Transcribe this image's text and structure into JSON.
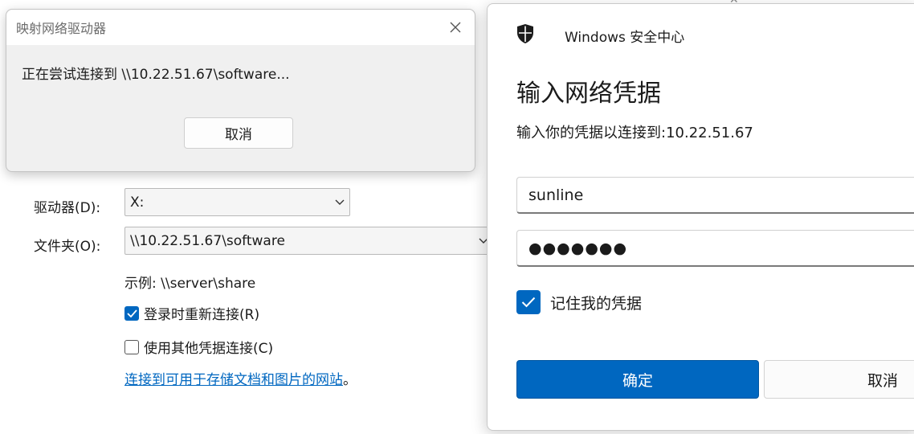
{
  "map_drive": {
    "drive_label": "驱动器(D):",
    "drive_value": "X:",
    "folder_label": "文件夹(O):",
    "folder_value": "\\\\10.22.51.67\\software",
    "example": "示例: \\\\server\\share",
    "reconnect_label": "登录时重新连接(R)",
    "reconnect_checked": true,
    "other_cred_label": "使用其他凭据连接(C)",
    "other_cred_checked": false,
    "link_text": "连接到可用于存储文档和图片的网站",
    "link_suffix": "。"
  },
  "progress_popup": {
    "title": "映射网络驱动器",
    "message": "正在尝试连接到 \\\\10.22.51.67\\software...",
    "cancel_label": "取消"
  },
  "security_dialog": {
    "app_title": "Windows 安全中心",
    "heading": "输入网络凭据",
    "subtitle": "输入你的凭据以连接到:10.22.51.67",
    "username_value": "sunline",
    "password_mask": "●●●●●●●",
    "remember_label": "记住我的凭据",
    "remember_checked": true,
    "ok_label": "确定",
    "cancel_label": "取消"
  },
  "colors": {
    "accent": "#0067c0",
    "popup_bg": "#f0f0f0"
  },
  "icons": [
    "shield-icon",
    "close-icon",
    "chevron-down-icon",
    "checkmark-icon"
  ]
}
